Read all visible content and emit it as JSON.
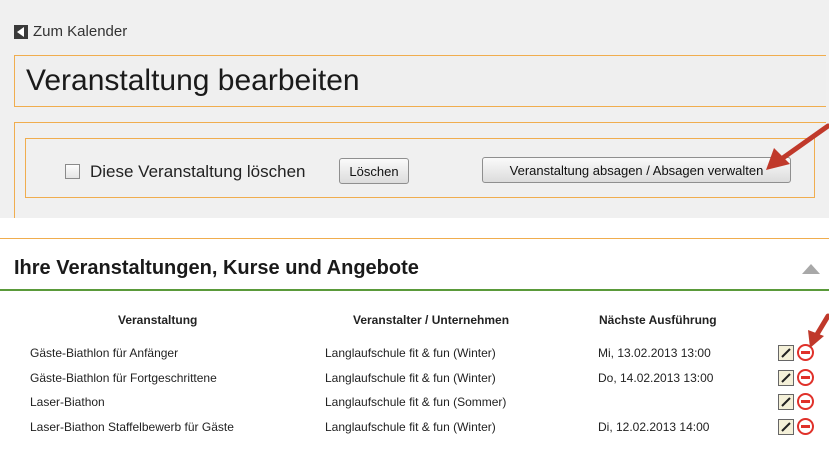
{
  "nav": {
    "back_label": "Zum Kalender"
  },
  "page": {
    "title": "Veranstaltung bearbeiten"
  },
  "actions": {
    "delete_checkbox_label": "Diese Veranstaltung löschen",
    "delete_button": "Löschen",
    "cancel_button": "Veranstaltung absagen / Absagen verwalten"
  },
  "panel": {
    "title": "Ihre Veranstaltungen, Kurse und Angebote",
    "columns": [
      "Veranstaltung",
      "Veranstalter / Unternehmen",
      "Nächste Ausführung"
    ],
    "rows": [
      {
        "event": "Gäste-Biathlon für Anfänger",
        "organizer": "Langlaufschule fit & fun (Winter)",
        "next": "Mi, 13.02.2013 13:00"
      },
      {
        "event": "Gäste-Biathlon für Fortgeschrittene",
        "organizer": "Langlaufschule fit & fun (Winter)",
        "next": "Do, 14.02.2013 13:00"
      },
      {
        "event": "Laser-Biathon",
        "organizer": "Langlaufschule fit & fun (Sommer)",
        "next": ""
      },
      {
        "event": "Laser-Biathon Staffelbewerb für Gäste",
        "organizer": "Langlaufschule fit & fun (Winter)",
        "next": "Di, 12.02.2013 14:00"
      }
    ]
  },
  "colors": {
    "accent_orange": "#f0ad4e",
    "header_green": "#5a9a3a",
    "remove_red": "#e0312a",
    "arrow_red": "#c0392b"
  },
  "icons": [
    "back-arrow-icon",
    "edit-icon",
    "remove-icon",
    "collapse-icon",
    "annotation-arrow"
  ]
}
